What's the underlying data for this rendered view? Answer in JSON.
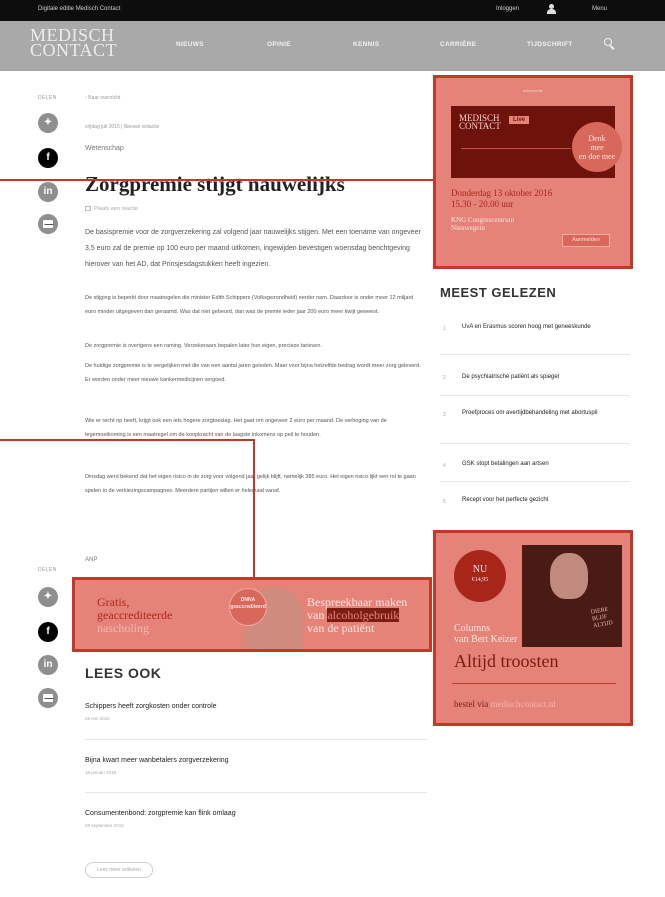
{
  "topbar": {
    "left_text": "Digitale editie Medisch Contact",
    "login": "Inloggen",
    "menu": "Menu"
  },
  "nav": {
    "logo_line1": "MEDISCH",
    "logo_line2": "CONTACT",
    "items": [
      "NIEUWS",
      "OPINIE",
      "KENNIS",
      "CARRIÈRE",
      "TIJDSCHRIFT"
    ]
  },
  "share": {
    "label": "DELEN"
  },
  "article": {
    "breadcrumb": "‹ Naar overzicht",
    "meta": "vrijdag juli 2015  |  Nieuws redactie",
    "category": "Wetenschap",
    "title": "Zorgpremie stijgt nauwelijks",
    "reaction": "Plaats een reactie",
    "lead": "De basispremie voor de zorgverzekering zal volgend jaar nauwelijks stijgen. Met een toename van ongeveer 3,5 euro zal de premie op 100 euro per maand uitkomen, ingewijden bevestigen woensdag berichtgeving hierover van het AD, dat Prinsjesdagstukken heeft ingezien.",
    "p2": "De stijging is beperkt door maatregelen die minister Edith Schippers (Volksgezondheid) eerder nam. Daardoor is onder meer 12 miljard euro minder uitgegeven dan geraamd. Was dat niet gebeurd, dan was de premie ieder jaar 200 euro meer kwijt geweest.",
    "p3": "De zorgpremie is overigens een raming. Verzekeraars bepalen later hun eigen, precieze tarieven.",
    "p4": "De huidige zorgpremie is te vergelijken met die van een aantal jaren geleden. Maar voor bijna hetzelfde bedrag wordt meer zorg geleverd. Er worden onder meer nieuwe kankermedicijnen vergoed.",
    "p5": "Wie er recht op heeft, krijgt ook een iets hogere zorgtoeslag. Het gaat om ongeveer 2 euro per maand. De verhoging van de tegemoetkoming is een maatregel om de koopkracht van de laagste inkomens op peil te houden.",
    "p6": "Dinsdag werd bekend dat het eigen risico in de zorg voor volgend jaar gelijk blijft, namelijk 385 euro. Het eigen risico lijkt een rol te gaan spelen in de verkiezingscampagnes. Meerdere partijen willen er helemaal vanaf.",
    "source": "ANP"
  },
  "banner_wide": {
    "left_line1": "Gratis,",
    "left_line2": "geaccrediteerde",
    "left_line3": "nascholing",
    "badge": "DNNA geaccrediteerd",
    "right_line1": "Bespreekbaar maken",
    "right_line2a": "van ",
    "right_line2b": "alcoholgebruik",
    "right_line3": "van de patiënt"
  },
  "lees_ook": {
    "heading": "LEES OOK",
    "items": [
      {
        "title": "Schippers heeft zorgkosten onder controle",
        "date": "26 mei 2016"
      },
      {
        "title": "Bijna kwart meer wanbetalers zorgverzekering",
        "date": "16 januari 2018"
      },
      {
        "title": "Consumentenbond: zorgpremie kan flink omlaag",
        "date": "28 september 2016"
      }
    ],
    "more": "Lees meer artikelen"
  },
  "ad_top": {
    "small": "advertentie",
    "logo1": "MEDISCH",
    "logo2": "CONTACT",
    "live": "Live",
    "circle1": "Denk",
    "circle2": "mee",
    "circle3": "en doe mee",
    "date1": "Donderdag 13 oktober 2016",
    "date2": "15.30 - 20.00 uur",
    "venue1": "KNG Congrescentrum",
    "venue2": "Nieuwegein",
    "button": "Aanmelden"
  },
  "meest_gelezen": {
    "heading": "MEEST GELEZEN",
    "items": [
      {
        "num": "1",
        "title": "UvA en Erasmus scoren hoog met geneeskunde"
      },
      {
        "num": "2",
        "title": "De psychiatrische patiënt als spiegel"
      },
      {
        "num": "3",
        "title": "Proefproces om avertijdbehandeling met abortuspil"
      },
      {
        "num": "4",
        "title": "GSK stopt betalingen aan artsen"
      },
      {
        "num": "5",
        "title": "Recept voor het perfecte gezicht"
      }
    ]
  },
  "ad_bottom": {
    "nu": "NU",
    "price": "€14,95",
    "cover": "DIERE BLIJF ALTIJD",
    "columns1": "Columns",
    "columns2": "van Bert Keizer",
    "title": "Altijd troosten",
    "bestel": "bestel via ",
    "url": "medischcontact.nl"
  }
}
